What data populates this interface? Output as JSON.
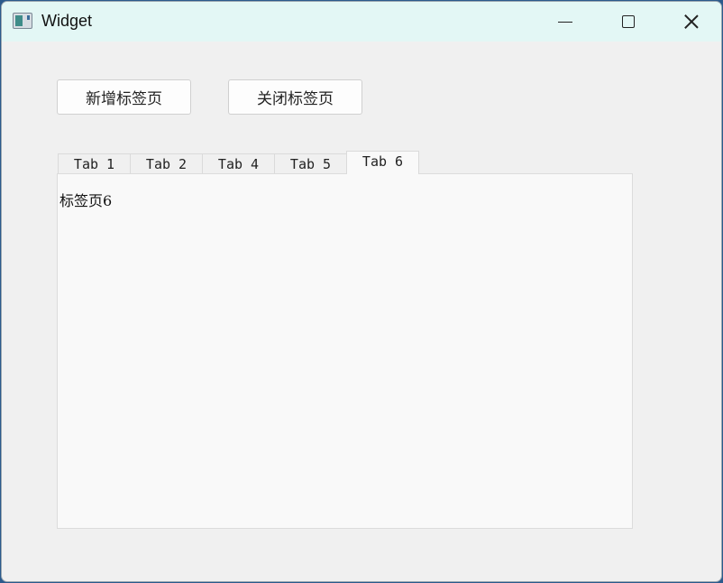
{
  "window": {
    "title": "Widget",
    "icon": "app-window-icon",
    "controls": {
      "minimize": "minimize-icon",
      "maximize": "maximize-icon",
      "close": "close-icon"
    }
  },
  "toolbar": {
    "add_label": "新增标签页",
    "close_label": "关闭标签页"
  },
  "tabs": [
    {
      "label": "Tab 1",
      "active": false
    },
    {
      "label": "Tab 2",
      "active": false
    },
    {
      "label": "Tab 4",
      "active": false
    },
    {
      "label": "Tab 5",
      "active": false
    },
    {
      "label": "Tab 6",
      "active": true
    }
  ],
  "page": {
    "content": "标签页6"
  },
  "colors": {
    "titlebar": "#e3f7f5",
    "window_bg": "#f0f0f0",
    "tab_page_bg": "#f9f9f9"
  }
}
